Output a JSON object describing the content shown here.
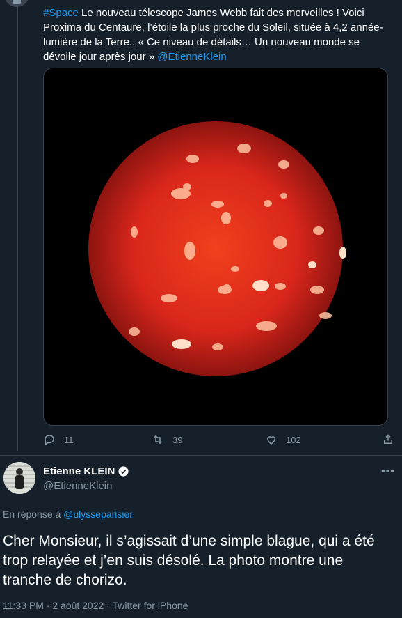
{
  "tweet1": {
    "hashtag": "#Space",
    "text": " Le nouveau télescope James Webb fait des merveilles ! Voici Proxima du Centaure, l’étoile la plus proche du Soleil, située à 4,2 année-lumière de la Terre.. « Ce niveau de détails… Un nouveau monde se dévoile jour après jour » ",
    "mention": "@EtienneKlein",
    "actions": {
      "replies": "11",
      "retweets": "39",
      "likes": "102"
    }
  },
  "reply": {
    "name": "Etienne KLEIN",
    "handle": "@EtienneKlein",
    "replying_prefix": "En réponse à ",
    "replying_to": "@ulysseparisier",
    "text": "Cher Monsieur, il s’agissait d’une simple blague, qui a été trop relayée et j’en suis désolé. La photo montre une tranche de chorizo.",
    "timestamp": "11:33 PM · 2 août 2022 · Twitter for iPhone"
  },
  "colors": {
    "background": "#15202b",
    "accent": "#1d9bf0",
    "secondary_text": "#8899a6",
    "border": "#38444d"
  },
  "icons": [
    "reply-icon",
    "retweet-icon",
    "like-icon",
    "share-icon",
    "verified-badge-icon",
    "more-icon"
  ]
}
